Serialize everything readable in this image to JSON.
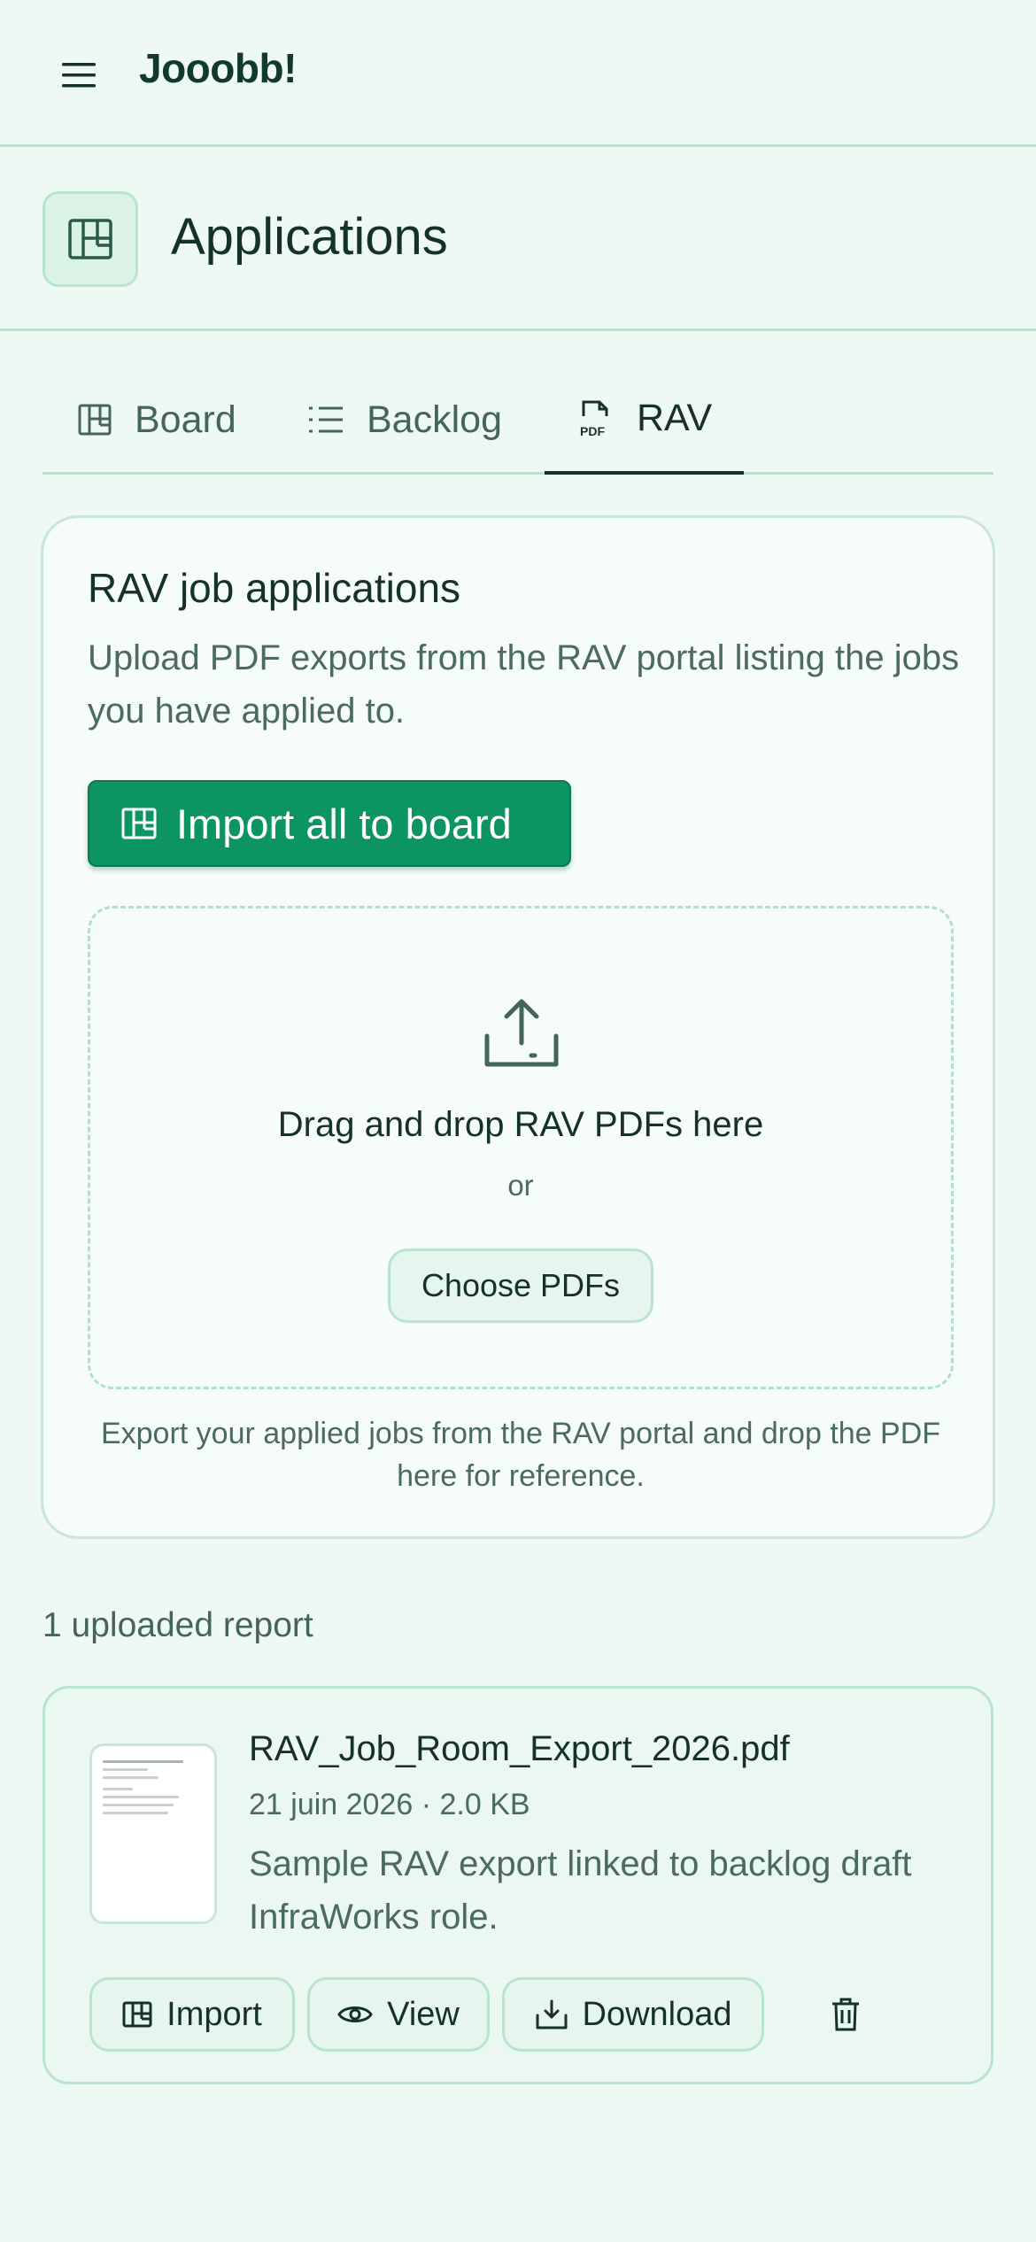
{
  "app": {
    "brand": "Jooobb!"
  },
  "header": {
    "menu_icon": "hamburger-menu-icon"
  },
  "page": {
    "title": "Applications",
    "icon": "kanban-board-icon"
  },
  "tabs": [
    {
      "label": "Board",
      "icon": "board-icon",
      "active": false
    },
    {
      "label": "Backlog",
      "icon": "list-icon",
      "active": false
    },
    {
      "label": "RAV",
      "icon": "pdf-file-icon",
      "active": true
    }
  ],
  "rav_card": {
    "title": "RAV job applications",
    "description": "Upload PDF exports from the RAV portal listing the jobs you have applied to.",
    "import_all_label": "Import all to board",
    "dropzone": {
      "title": "Drag and drop RAV PDFs here",
      "or": "or",
      "choose_label": "Choose PDFs"
    },
    "hint": "Export your applied jobs from the RAV portal and drop the PDF here for reference."
  },
  "reports": {
    "count_label": "1 uploaded report",
    "items": [
      {
        "file_name": "RAV_Job_Room_Export_2026.pdf",
        "meta": "21 juin 2026 · 2.0 KB",
        "note": "Sample RAV export linked to backlog draft InfraWorks role.",
        "actions": {
          "import": "Import",
          "view": "View",
          "download": "Download"
        }
      }
    ]
  },
  "colors": {
    "background": "#eef9f3",
    "primary": "#0d9463",
    "border": "#b8e4cf",
    "text": "#143226",
    "muted": "#4a6b5e"
  }
}
